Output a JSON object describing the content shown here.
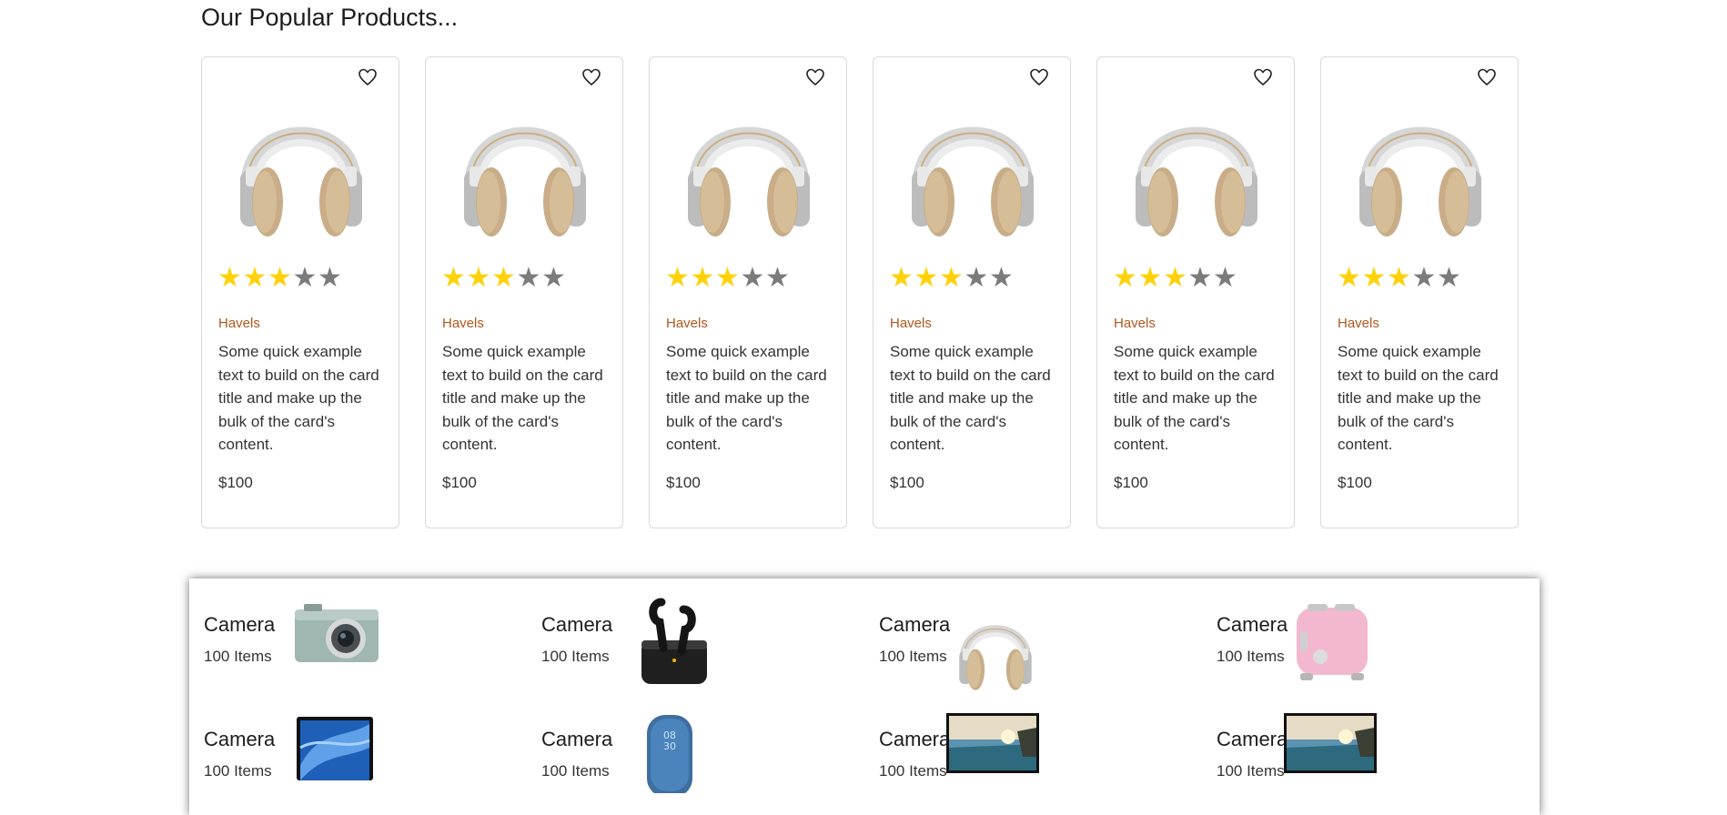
{
  "section_title": "Our Popular Products...",
  "products": [
    {
      "brand": "Havels",
      "description": "Some quick example text to build on the card title and make up the bulk of the card's content.",
      "price": "$100",
      "rating": 3,
      "rating_max": 5
    },
    {
      "brand": "Havels",
      "description": "Some quick example text to build on the card title and make up the bulk of the card's content.",
      "price": "$100",
      "rating": 3,
      "rating_max": 5
    },
    {
      "brand": "Havels",
      "description": "Some quick example text to build on the card title and make up the bulk of the card's content.",
      "price": "$100",
      "rating": 3,
      "rating_max": 5
    },
    {
      "brand": "Havels",
      "description": "Some quick example text to build on the card title and make up the bulk of the card's content.",
      "price": "$100",
      "rating": 3,
      "rating_max": 5
    },
    {
      "brand": "Havels",
      "description": "Some quick example text to build on the card title and make up the bulk of the card's content.",
      "price": "$100",
      "rating": 3,
      "rating_max": 5
    },
    {
      "brand": "Havels",
      "description": "Some quick example text to build on the card title and make up the bulk of the card's content.",
      "price": "$100",
      "rating": 3,
      "rating_max": 5
    }
  ],
  "categories": [
    {
      "name": "Camera",
      "count": "100 Items",
      "icon": "camera-image"
    },
    {
      "name": "Camera",
      "count": "100 Items",
      "icon": "earbuds-image"
    },
    {
      "name": "Camera",
      "count": "100 Items",
      "icon": "headphones-image"
    },
    {
      "name": "Camera",
      "count": "100 Items",
      "icon": "toaster-image"
    },
    {
      "name": "Camera",
      "count": "100 Items",
      "icon": "laptop-image"
    },
    {
      "name": "Camera",
      "count": "100 Items",
      "icon": "speaker-image"
    },
    {
      "name": "Camera",
      "count": "100 Items",
      "icon": "tv-image"
    },
    {
      "name": "Camera",
      "count": "100 Items",
      "icon": "tv-image"
    }
  ],
  "colors": {
    "star_on": "#fdd20a",
    "star_off": "#7b7b7b",
    "brand": "#b0571e"
  }
}
